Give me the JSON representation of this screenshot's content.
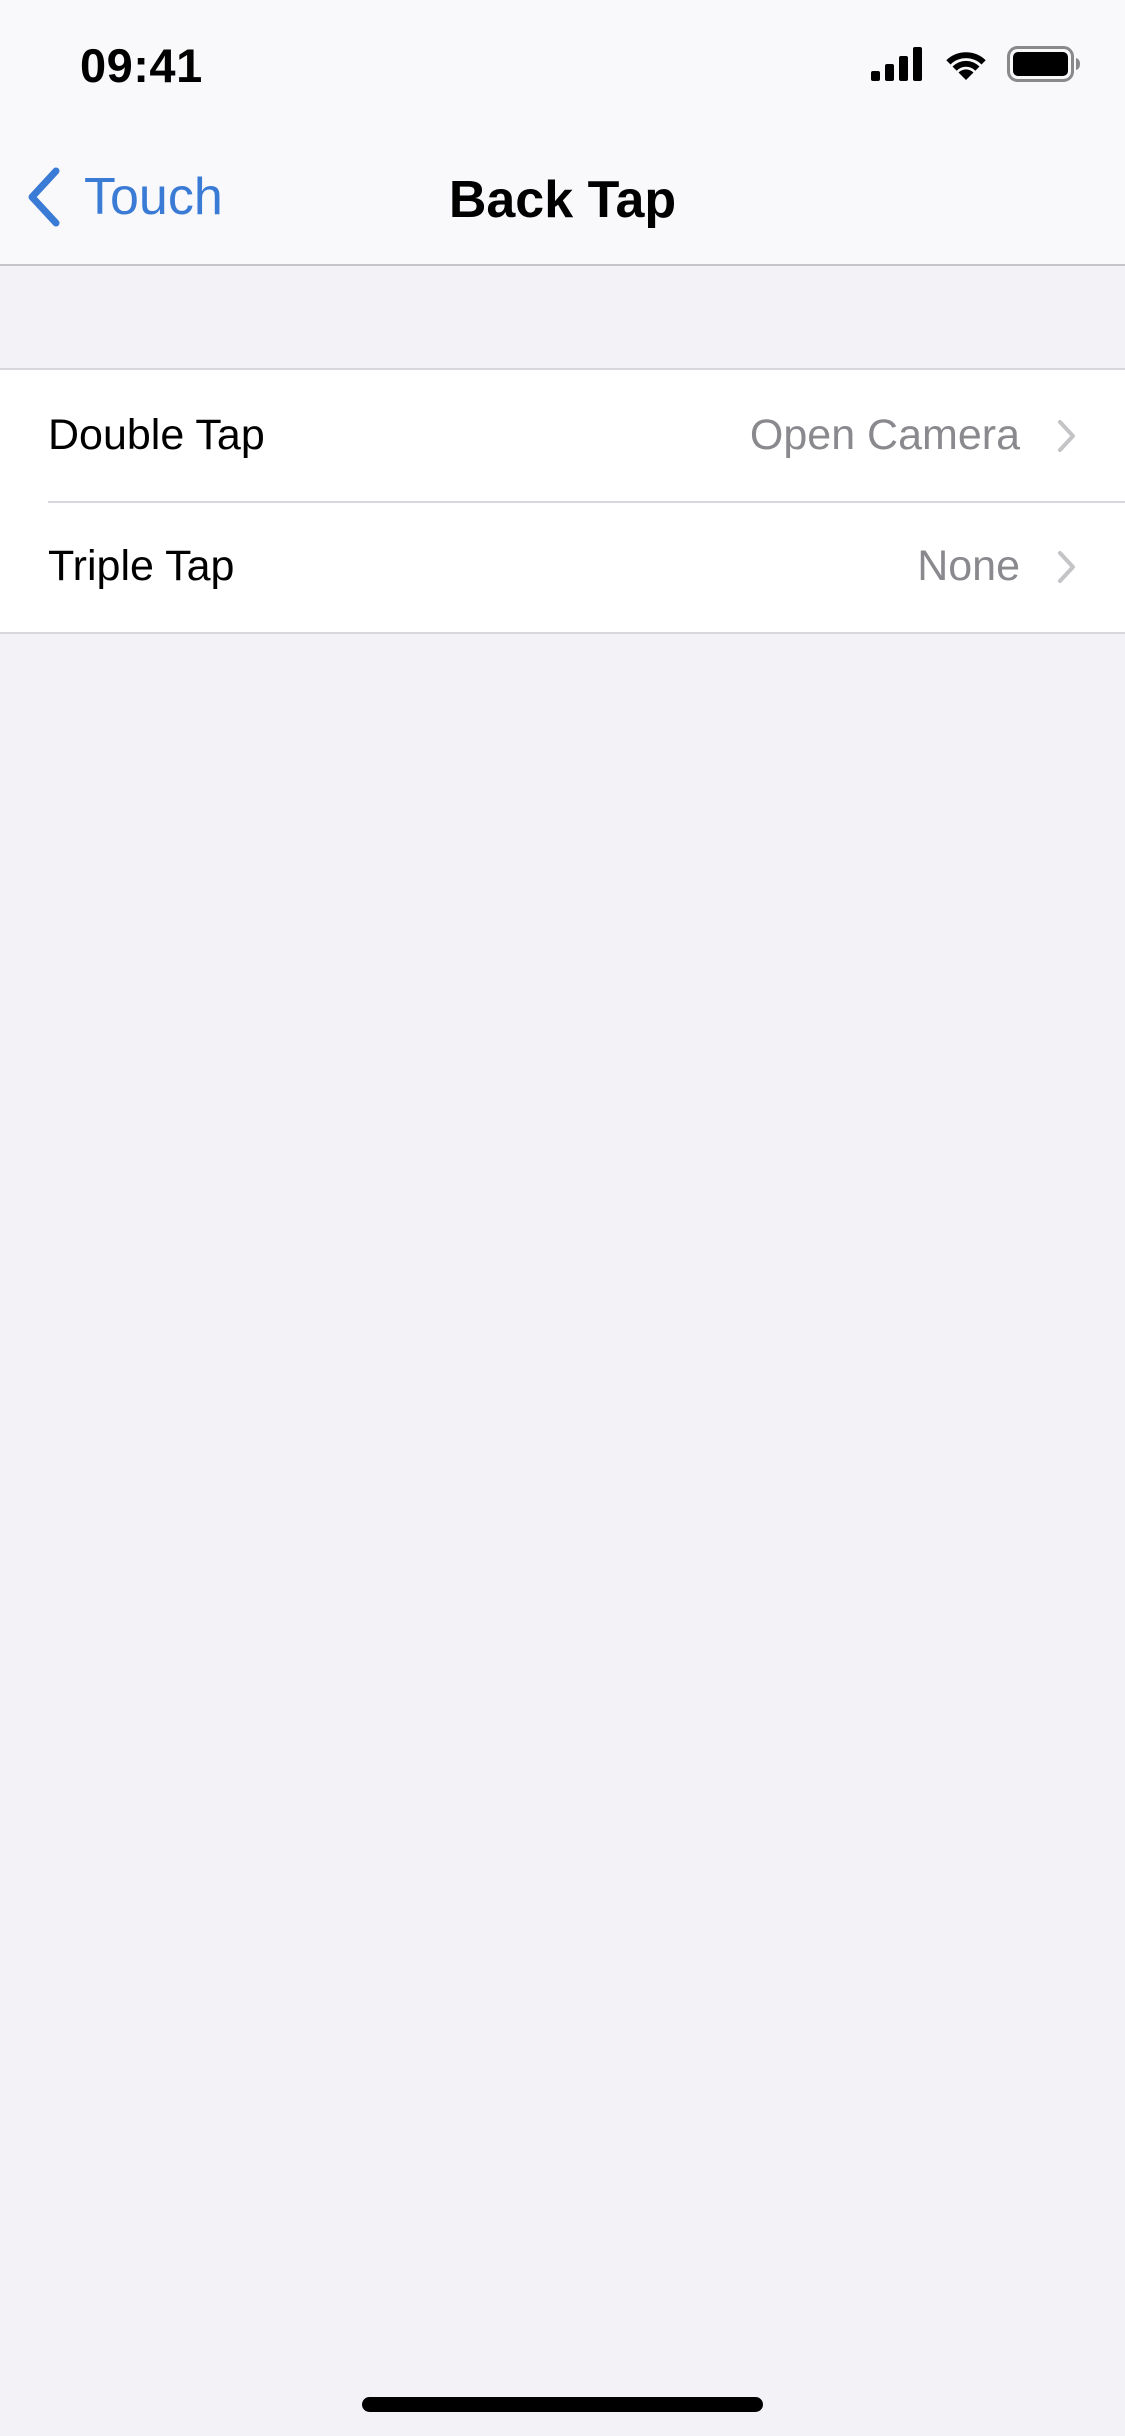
{
  "status_bar": {
    "time": "09:41",
    "icons": [
      "cellular-signal-icon",
      "wifi-icon",
      "battery-icon"
    ]
  },
  "nav": {
    "back_label": "Touch",
    "title": "Back Tap"
  },
  "settings": {
    "rows": [
      {
        "label": "Double Tap",
        "value": "Open Camera"
      },
      {
        "label": "Triple Tap",
        "value": "None"
      }
    ]
  },
  "colors": {
    "accent": "#3a7bd5",
    "background": "#f2f2f7",
    "secondary_text": "#8a8a8e",
    "separator": "#d8d8dc"
  }
}
